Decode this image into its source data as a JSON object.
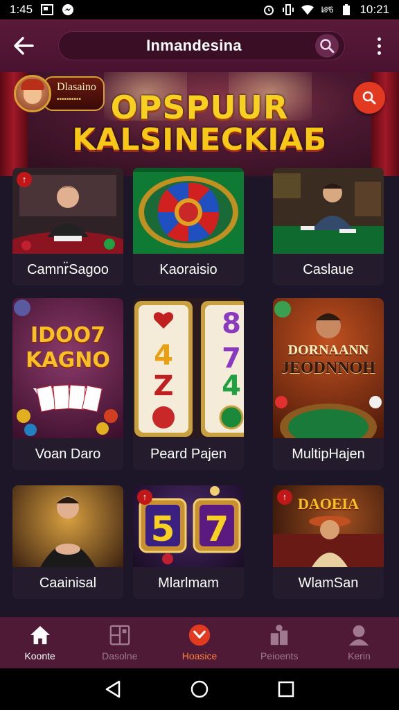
{
  "status_bar": {
    "time_left": "1:45",
    "network_text": "I∕∕∕∕6",
    "time_right": "10:21"
  },
  "app_bar": {
    "title": "Inmandesina"
  },
  "hero": {
    "brand_name": "Dlasaino",
    "line1": "OPSPUUR",
    "line2": "KALSINECKIAБ"
  },
  "games": [
    {
      "label": "Camnr̈Sagoo",
      "ribbon": "",
      "tag": "↑"
    },
    {
      "label": "Kaoraisio",
      "ribbon": "",
      "tag": ""
    },
    {
      "label": "Caslaue",
      "ribbon": "",
      "tag": ""
    },
    {
      "label": "Voan Daro",
      "ribbon": "",
      "tag": "",
      "art_line1": "IDOO7",
      "art_line2": "KAGNO"
    },
    {
      "label": "Peard Pajen",
      "ribbon": "",
      "tag": ""
    },
    {
      "label": "MultipHajen",
      "ribbon": "",
      "tag": "",
      "art_line1": "DORNAANN",
      "art_line2": "JEODNNOH"
    },
    {
      "label": "Caainisal",
      "ribbon": "",
      "tag": ""
    },
    {
      "label": "Mlarlmam",
      "ribbon": "",
      "tag": "↑"
    },
    {
      "label": "WlamSan",
      "ribbon": "",
      "tag": "↑",
      "art_line1": "DAOEIA"
    }
  ],
  "bottom_nav": [
    {
      "label": "Koonte",
      "icon": "home-icon"
    },
    {
      "label": "Dasolne",
      "icon": "cards-icon"
    },
    {
      "label": "Hoasice",
      "icon": "promo-icon"
    },
    {
      "label": "Peioents",
      "icon": "chips-icon"
    },
    {
      "label": "Kerin",
      "icon": "profile-icon"
    }
  ],
  "colors": {
    "app_bar": "#5a1a3a",
    "accent_red": "#e23a20",
    "gold": "#f8d020",
    "nav_bg": "#4e1a36"
  }
}
